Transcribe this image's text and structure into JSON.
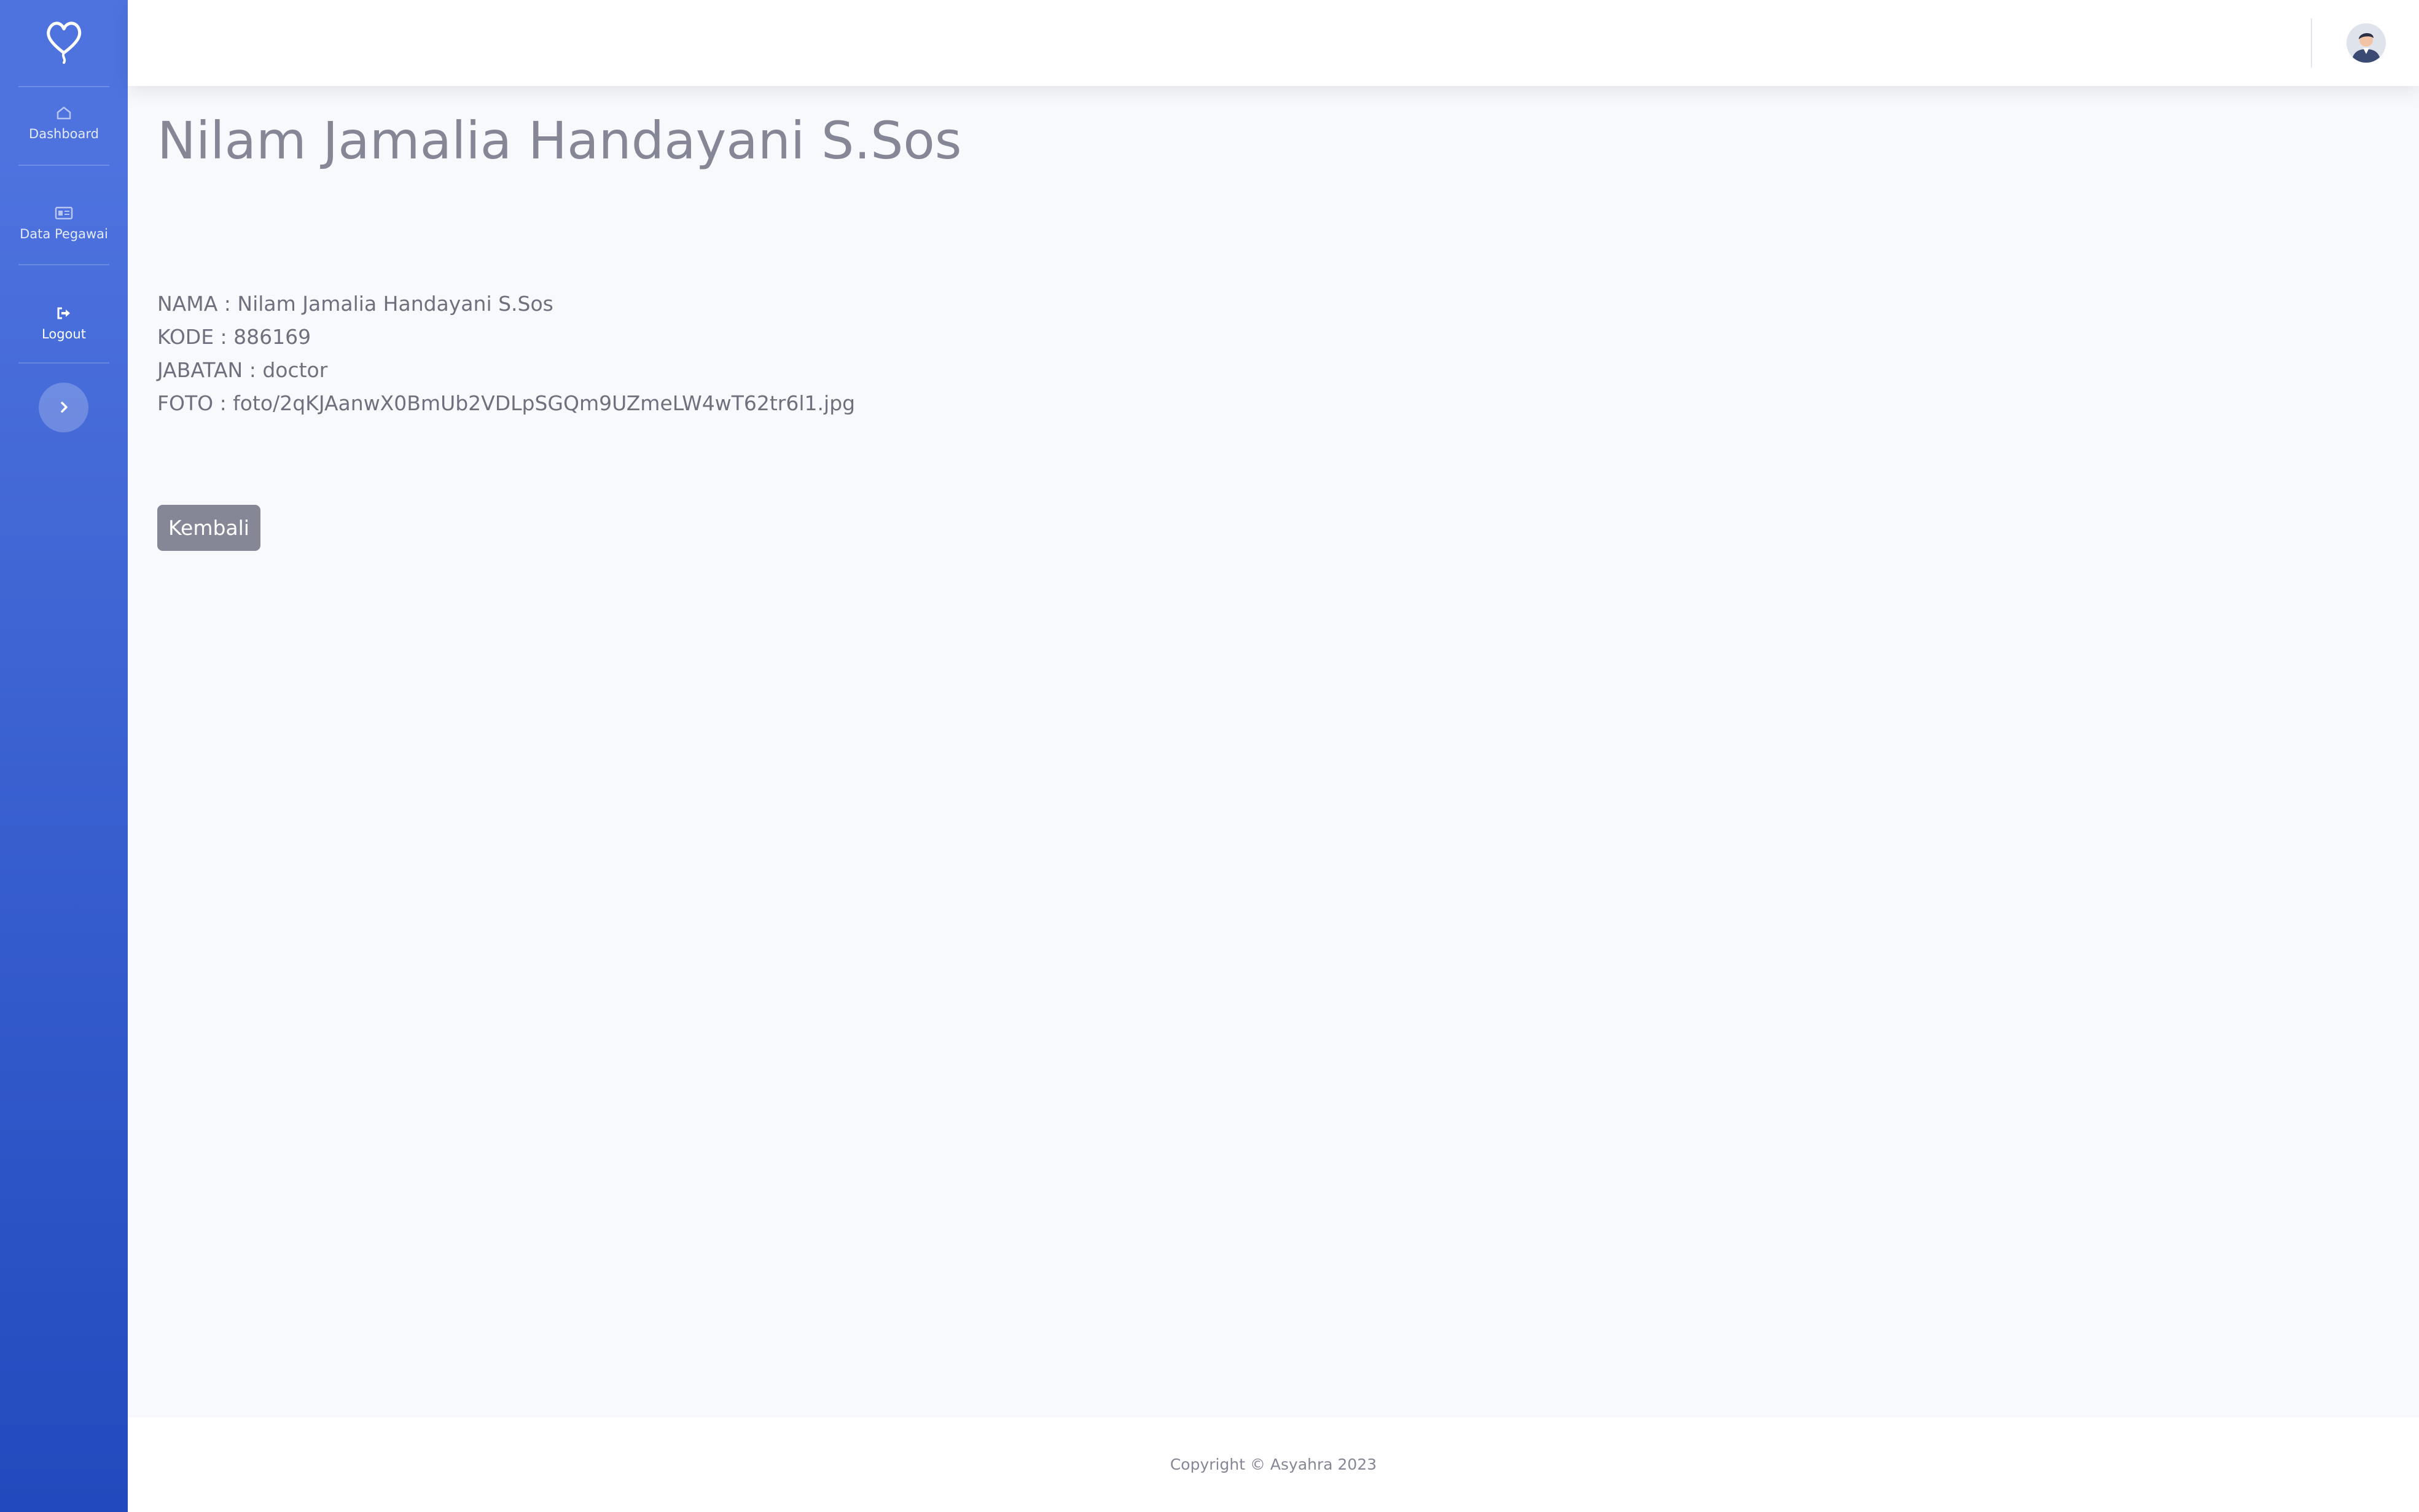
{
  "sidebar": {
    "brand_icon": "heart-balloon-icon",
    "items": [
      {
        "label": "Dashboard",
        "icon": "home-icon"
      },
      {
        "label": "Data Pegawai",
        "icon": "id-card-icon"
      },
      {
        "label": "Logout",
        "icon": "sign-out-icon"
      }
    ],
    "toggle_icon": "chevron-right-icon"
  },
  "topbar": {
    "user_avatar": "user-avatar-icon"
  },
  "main": {
    "title": "Nilam Jamalia Handayani S.Sos",
    "details": [
      "NAMA : Nilam Jamalia Handayani S.Sos",
      "KODE : 886169",
      "JABATAN : doctor",
      "FOTO : foto/2qKJAanwX0BmUb2VDLpSGQm9UZmeLW4wT62tr6l1.jpg"
    ],
    "back_button": "Kembali"
  },
  "footer": {
    "copyright": "Copyright © Asyahra 2023"
  },
  "colors": {
    "sidebar_gradient_start": "#4e73df",
    "sidebar_gradient_end": "#224abe",
    "page_background": "#f8f9fc",
    "button_secondary": "#858796"
  }
}
